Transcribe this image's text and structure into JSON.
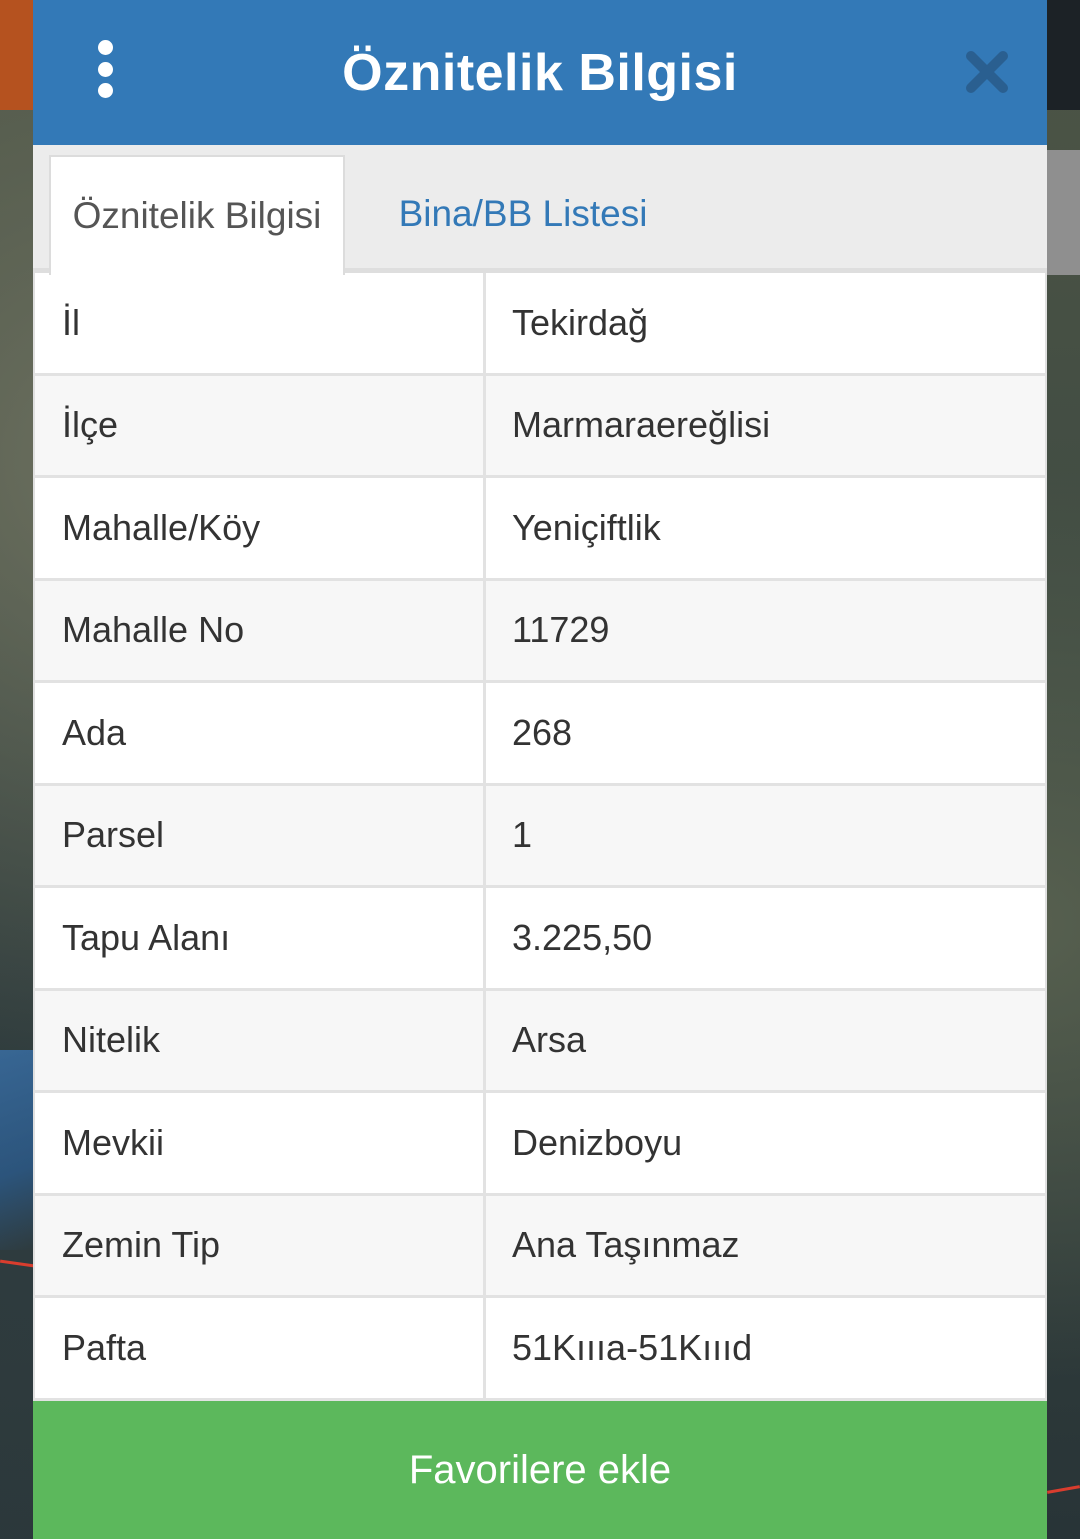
{
  "header": {
    "title": "Öznitelik Bilgisi",
    "menu_icon": "vertical-dots-icon",
    "close_icon": "close-icon",
    "color": "#3379b7"
  },
  "tabs": [
    {
      "label": "Öznitelik Bilgisi",
      "active": true
    },
    {
      "label": "Bina/BB Listesi",
      "active": false
    }
  ],
  "attributes": [
    {
      "label": "İl",
      "value": "Tekirdağ"
    },
    {
      "label": "İlçe",
      "value": "Marmaraereğlisi"
    },
    {
      "label": "Mahalle/Köy",
      "value": "Yeniçiftlik"
    },
    {
      "label": "Mahalle No",
      "value": "11729"
    },
    {
      "label": "Ada",
      "value": "268"
    },
    {
      "label": "Parsel",
      "value": "1"
    },
    {
      "label": "Tapu Alanı",
      "value": "3.225,50"
    },
    {
      "label": "Nitelik",
      "value": "Arsa"
    },
    {
      "label": "Mevkii",
      "value": "Denizboyu"
    },
    {
      "label": "Zemin Tip",
      "value": "Ana Taşınmaz"
    },
    {
      "label": "Pafta",
      "value": "51Kıııa-51Kıııd"
    }
  ],
  "footer": {
    "favorite_label": "Favorilere ekle",
    "color": "#5cb85c"
  }
}
